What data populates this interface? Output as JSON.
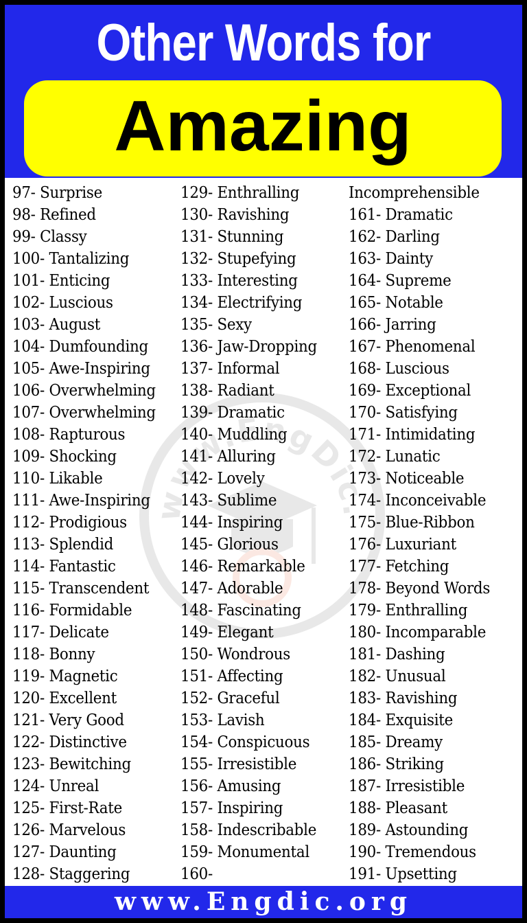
{
  "header": {
    "title": "Other Words for",
    "subtitle": "Amazing",
    "colors": {
      "band": "#2228ea",
      "pill": "#ffff00",
      "title_text": "#ffffff",
      "subtitle_text": "#000000"
    }
  },
  "watermark": {
    "text": "www.EngDic.org",
    "icon": "graduation-cap-logo"
  },
  "columns": [
    {
      "entries": [
        "97- Surprise",
        "98- Refined",
        "99- Classy",
        "100- Tantalizing",
        "101- Enticing",
        "102- Luscious",
        "103- August",
        "104- Dumfounding",
        "105- Awe-Inspiring",
        "106- Overwhelming",
        "107- Overwhelming",
        "108- Rapturous",
        "109- Shocking",
        "110- Likable",
        "111- Awe-Inspiring",
        "112- Prodigious",
        "113- Splendid",
        "114- Fantastic",
        "115- Transcendent",
        "116- Formidable",
        "117- Delicate",
        "118- Bonny",
        "119- Magnetic",
        "120- Excellent",
        "121- Very Good",
        "122- Distinctive",
        "123- Bewitching",
        "124- Unreal",
        "125- First-Rate",
        "126- Marvelous",
        "127- Daunting",
        "128- Staggering"
      ]
    },
    {
      "entries": [
        "129- Enthralling",
        "130- Ravishing",
        "131- Stunning",
        "132- Stupefying",
        "133- Interesting",
        "134- Electrifying",
        "135- Sexy",
        "136- Jaw-Dropping",
        "137- Informal",
        "138- Radiant",
        "139- Dramatic",
        "140- Muddling",
        "141- Alluring",
        "142- Lovely",
        "143- Sublime",
        "144- Inspiring",
        "145- Glorious",
        "146- Remarkable",
        "147- Adorable",
        "148- Fascinating",
        "149- Elegant",
        "150- Wondrous",
        "151- Affecting",
        "152- Graceful",
        "153- Lavish",
        "154- Conspicuous",
        "155- Irresistible",
        "156- Amusing",
        "157- Inspiring",
        "158- Indescribable",
        "159- Monumental",
        "160-"
      ]
    },
    {
      "entries": [
        "Incomprehensible",
        "161- Dramatic",
        "162- Darling",
        "163- Dainty",
        "164- Supreme",
        "165- Notable",
        "166- Jarring",
        "167- Phenomenal",
        "168- Luscious",
        "169- Exceptional",
        "170- Satisfying",
        "171- Intimidating",
        "172- Lunatic",
        "173- Noticeable",
        "174- Inconceivable",
        "175- Blue-Ribbon",
        "176- Luxuriant",
        "177- Fetching",
        "178- Beyond Words",
        "179- Enthralling",
        "180- Incomparable",
        "181- Dashing",
        "182- Unusual",
        "183- Ravishing",
        "184- Exquisite",
        "185- Dreamy",
        "186- Striking",
        "187- Irresistible",
        "188- Pleasant",
        "189- Astounding",
        "190- Tremendous",
        "191- Upsetting"
      ]
    }
  ],
  "footer": {
    "url": "www.Engdic.org"
  }
}
